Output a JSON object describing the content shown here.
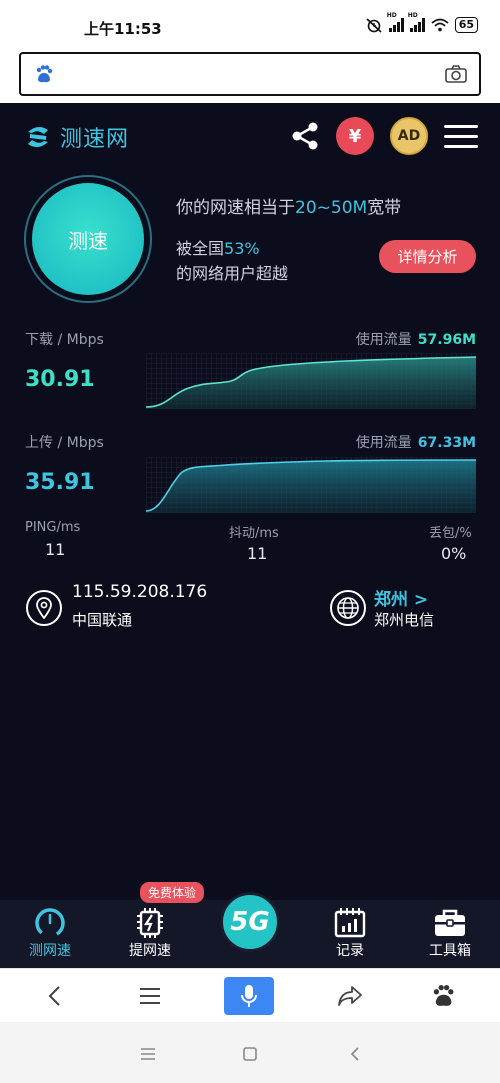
{
  "status": {
    "time": "上午11:53",
    "battery": "65",
    "hd": "HD"
  },
  "header": {
    "logo_text": "测速网",
    "yen_label": "¥",
    "ad_label": "AD"
  },
  "hero": {
    "button_label": "测速",
    "line1_prefix": "你的网速相当于",
    "line1_highlight": "20~50M",
    "line1_suffix": "宽带",
    "line2_prefix": "被全国",
    "line2_highlight": "53%",
    "line3": "的网络用户超越",
    "detail_button": "详情分析"
  },
  "download": {
    "label": "下载 / Mbps",
    "value": "30.91",
    "usage_label": "使用流量",
    "usage_value": "57.96M"
  },
  "upload": {
    "label": "上传 / Mbps",
    "value": "35.91",
    "usage_label": "使用流量",
    "usage_value": "67.33M"
  },
  "stats": {
    "ping_label": "PING/ms",
    "ping_value": "11",
    "jitter_label": "抖动/ms",
    "jitter_value": "11",
    "loss_label": "丢包/%",
    "loss_value": "0%"
  },
  "location": {
    "ip": "115.59.208.176",
    "isp": "中国联通",
    "server_city": "郑州 >",
    "server_isp": "郑州电信"
  },
  "tabs": {
    "speedtest": "测网速",
    "boost": "提网速",
    "boost_badge": "免费体验",
    "center": "5G",
    "records": "记录",
    "tools": "工具箱"
  },
  "colors": {
    "accent": "#3fc4e0",
    "green": "#3de0c7",
    "red": "#e8525c",
    "bg": "#0b0d1c"
  }
}
